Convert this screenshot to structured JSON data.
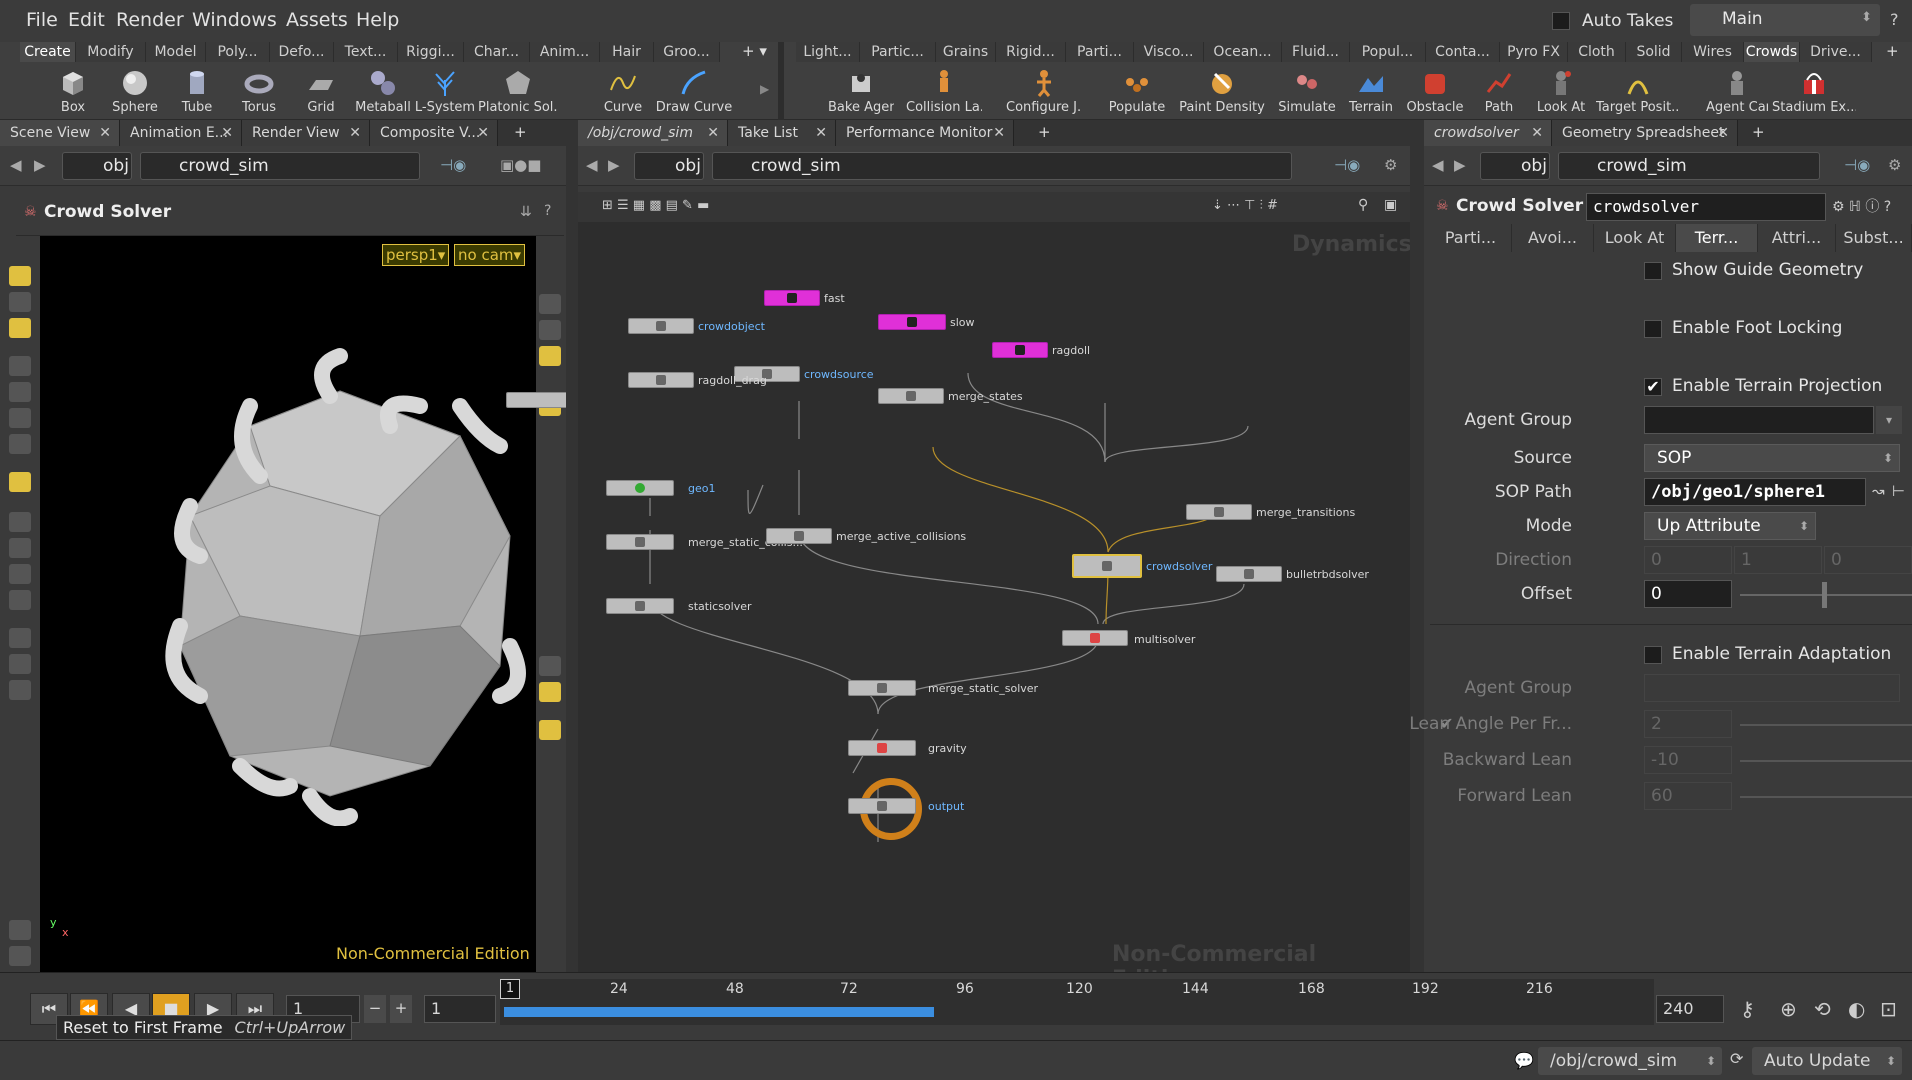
{
  "menubar": {
    "items": [
      "File",
      "Edit",
      "Render",
      "Windows",
      "Assets",
      "Help"
    ],
    "auto_takes": "Auto Takes",
    "desktop": "Main"
  },
  "shelf_left": {
    "tabs": [
      "Create",
      "Modify",
      "Model",
      "Poly...",
      "Defo...",
      "Text...",
      "Riggi...",
      "Char...",
      "Anim...",
      "Hair",
      "Groo..."
    ],
    "tools": [
      "Box",
      "Sphere",
      "Tube",
      "Torus",
      "Grid",
      "Metaball",
      "L-System",
      "Platonic Sol...",
      "Curve",
      "Draw Curve"
    ]
  },
  "shelf_right": {
    "tabs": [
      "Light...",
      "Partic...",
      "Grains",
      "Rigid...",
      "Parti...",
      "Visco...",
      "Ocean...",
      "Fluid...",
      "Popul...",
      "Conta...",
      "Pyro FX",
      "Cloth",
      "Solid",
      "Wires",
      "Crowds",
      "Drive..."
    ],
    "tools": [
      "Bake Agent",
      "Collision La...",
      "Configure J...",
      "Populate",
      "Paint Density",
      "Simulate",
      "Terrain",
      "Obstacle",
      "Path",
      "Look At",
      "Target Posit...",
      "Agent Cam",
      "Stadium Ex..."
    ]
  },
  "left_pane": {
    "tabs": [
      "Scene View",
      "Animation E...",
      "Render View",
      "Composite V..."
    ],
    "path": [
      "obj",
      "crowd_sim"
    ],
    "title": "Crowd Solver",
    "cam1": "persp1▾",
    "cam2": "no cam▾",
    "watermark": "Non-Commercial Edition"
  },
  "mid_pane": {
    "tabs": [
      "/obj/crowd_sim",
      "Take List",
      "Performance Monitor"
    ],
    "path": [
      "obj",
      "crowd_sim"
    ],
    "context": "Dynamics",
    "watermark": "Non-Commercial Edition",
    "nodes": {
      "fast": "fast",
      "slow": "slow",
      "ragdoll": "ragdoll",
      "crowdobject": "crowdobject",
      "crowdsource": "crowdsource",
      "ragdoll_drag": "ragdoll_drag",
      "merge_states": "merge_states",
      "geo1": "geo1",
      "merge_transitions": "merge_transitions",
      "merge_static_coll": "merge_static_collis...",
      "merge_active_collisions": "merge_active_collisions",
      "crowdsolver": "crowdsolver",
      "bulletrbdsolver": "bulletrbdsolver",
      "staticsolver": "staticsolver",
      "multisolver": "multisolver",
      "merge_static_solver": "merge_static_solver",
      "gravity": "gravity",
      "output": "output"
    }
  },
  "right_pane": {
    "tabs": [
      "crowdsolver",
      "Geometry Spreadsheet"
    ],
    "path": [
      "obj",
      "crowd_sim"
    ],
    "node_type": "Crowd Solver",
    "node_name": "crowdsolver",
    "param_tabs": [
      "Parti...",
      "Avoi...",
      "Look At",
      "Terr...",
      "Attri...",
      "Subst..."
    ],
    "show_guide": "Show Guide Geometry",
    "foot_lock": "Enable Foot Locking",
    "terrain_proj": "Enable Terrain Projection",
    "agent_group_label": "Agent Group",
    "source_label": "Source",
    "source_value": "SOP",
    "sop_path_label": "SOP Path",
    "sop_path_value": "/obj/geo1/sphere1",
    "mode_label": "Mode",
    "mode_value": "Up Attribute",
    "direction_label": "Direction",
    "dir_x": "0",
    "dir_y": "1",
    "dir_z": "0",
    "offset_label": "Offset",
    "offset_value": "0",
    "terrain_adapt": "Enable Terrain Adaptation",
    "agent_group2_label": "Agent Group",
    "lean_label": "Lean Angle Per Fr...",
    "lean_value": "2",
    "back_lean_label": "Backward Lean",
    "back_lean_value": "-10",
    "fwd_lean_label": "Forward Lean",
    "fwd_lean_value": "60"
  },
  "timeline": {
    "frame": "1",
    "start": "1",
    "current": "1",
    "end": "240",
    "ticks": [
      "24",
      "48",
      "72",
      "96",
      "120",
      "144",
      "168",
      "192",
      "216"
    ],
    "tooltip": "Reset to First Frame",
    "shortcut": "Ctrl+UpArrow"
  },
  "statusbar": {
    "path": "/obj/crowd_sim",
    "update": "Auto Update"
  }
}
